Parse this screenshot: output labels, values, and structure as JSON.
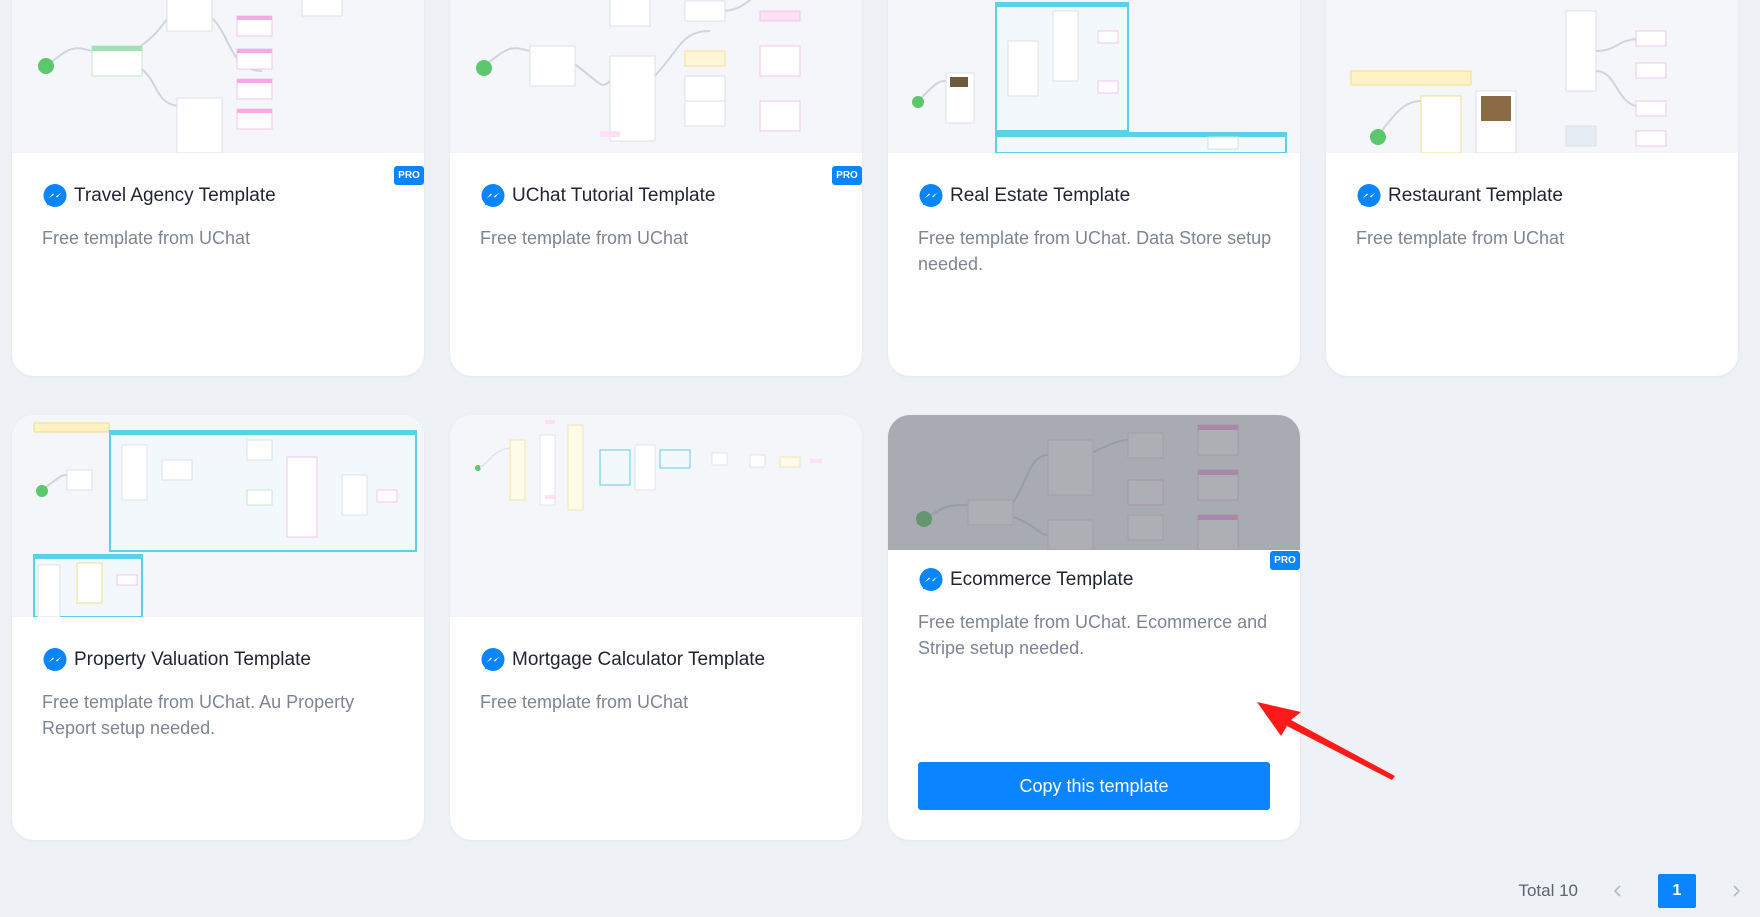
{
  "colors": {
    "page_background": "#eef1f5",
    "card_background": "#ffffff",
    "accent": "#0a84ff",
    "title_text": "#1f2430",
    "description_text": "#7d8593",
    "annotation_arrow": "#ff1a1a"
  },
  "icons": {
    "title_icon": "messenger-icon",
    "pagination_prev": "chevron-left-icon",
    "pagination_next": "chevron-right-icon"
  },
  "templates": [
    {
      "title": "Travel Agency Template",
      "description": "Free template from UChat",
      "badge": "PRO"
    },
    {
      "title": "UChat Tutorial Template",
      "description": "Free template from UChat",
      "badge": "PRO"
    },
    {
      "title": "Real Estate Template",
      "description": "Free template from UChat. Data Store setup needed."
    },
    {
      "title": "Restaurant Template",
      "description": "Free template from UChat"
    },
    {
      "title": "Property Valuation Template",
      "description": "Free template from UChat. Au Property Report setup needed."
    },
    {
      "title": "Mortgage Calculator Template",
      "description": "Free template from UChat"
    },
    {
      "title": "Ecommerce Template",
      "description": "Free template from UChat. Ecommerce and Stripe setup needed.",
      "badge": "PRO",
      "hovered": true,
      "action_label": "Copy this template"
    }
  ],
  "pagination": {
    "total_label": "Total 10",
    "current_page": "1"
  }
}
